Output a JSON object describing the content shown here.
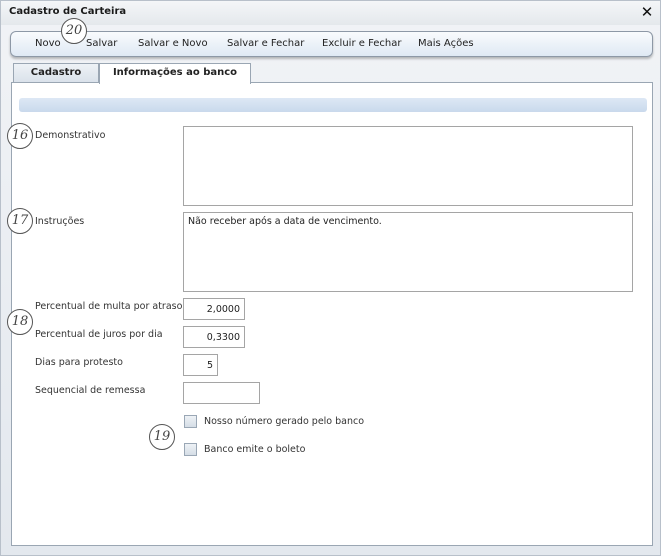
{
  "window": {
    "title": "Cadastro de Carteira",
    "close_glyph": "✕"
  },
  "toolbar": {
    "novo": "Novo",
    "salvar": "Salvar",
    "salvar_novo": "Salvar e Novo",
    "salvar_fechar": "Salvar e Fechar",
    "excluir_fechar": "Excluir e Fechar",
    "mais_acoes": "Mais Ações"
  },
  "tabs": {
    "cadastro": "Cadastro",
    "banco": "Informações ao banco"
  },
  "form": {
    "demonstrativo_label": "Demonstrativo",
    "demonstrativo_value": "",
    "instrucoes_label": "Instruções",
    "instrucoes_value": "Não receber após a data de vencimento.",
    "multa_label": "Percentual de multa por atraso",
    "multa_value": "2,0000",
    "juros_label": "Percentual de juros por dia",
    "juros_value": "0,3300",
    "protesto_label": "Dias para protesto",
    "protesto_value": "5",
    "sequencial_label": "Sequencial de remessa",
    "sequencial_value": "",
    "nosso_numero_label": "Nosso número gerado pelo banco",
    "nosso_numero_checked": false,
    "boleto_label": "Banco emite o boleto",
    "boleto_checked": false
  },
  "callouts": {
    "c20": "20",
    "c16": "16",
    "c17": "17",
    "c18": "18",
    "c19": "19"
  }
}
